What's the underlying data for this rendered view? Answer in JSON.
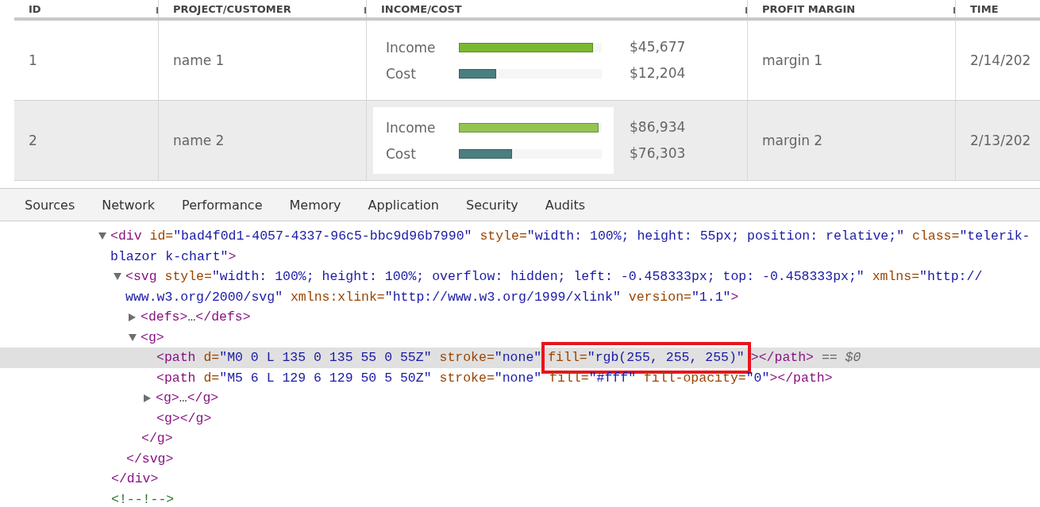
{
  "table": {
    "columns": [
      {
        "label": "ID"
      },
      {
        "label": "PROJECT/CUSTOMER"
      },
      {
        "label": "INCOME/COST"
      },
      {
        "label": "PROFIT MARGIN"
      },
      {
        "label": "TIME"
      }
    ],
    "rows": [
      {
        "id": "1",
        "name": "name 1",
        "hovered": false,
        "chart_white": false,
        "bars": [
          {
            "label": "Income",
            "level": 0.94,
            "color": "#7cb82f",
            "value": "$45,677"
          },
          {
            "label": "Cost",
            "level": 0.26,
            "color": "#4a7f80",
            "value": "$12,204"
          }
        ],
        "margin": "margin 1",
        "time": "2/14/202"
      },
      {
        "id": "2",
        "name": "name 2",
        "hovered": true,
        "chart_white": true,
        "bars": [
          {
            "label": "Income",
            "level": 0.98,
            "color": "#94c452",
            "value": "$86,934"
          },
          {
            "label": "Cost",
            "level": 0.37,
            "color": "#4a7f80",
            "value": "$76,303"
          }
        ],
        "margin": "margin 2",
        "time": "2/13/202"
      }
    ]
  },
  "devtools": {
    "tabs": [
      {
        "label": "Sources",
        "selected": false
      },
      {
        "label": "Network",
        "selected": false
      },
      {
        "label": "Performance",
        "selected": false
      },
      {
        "label": "Memory",
        "selected": false
      },
      {
        "label": "Application",
        "selected": false
      },
      {
        "label": "Security",
        "selected": false
      },
      {
        "label": "Audits",
        "selected": false
      }
    ],
    "tree": [
      {
        "expanded": true,
        "selected": false,
        "tokens": [
          {
            "kind": "tag",
            "text": "<div"
          },
          {
            "kind": "attr",
            "text": " id="
          },
          {
            "kind": "value",
            "text": "\"bad4f0d1-4057-4337-96c5-bbc9d96b7990\""
          },
          {
            "kind": "attr",
            "text": " style="
          },
          {
            "kind": "value",
            "text": "\"width: 100%; height: 55px; position: relative;\""
          },
          {
            "kind": "attr",
            "text": " class="
          },
          {
            "kind": "value",
            "text": "\"telerik-blazor k-chart\""
          },
          {
            "kind": "tag",
            "text": ">"
          }
        ],
        "children": [
          {
            "expanded": true,
            "selected": false,
            "tokens": [
              {
                "kind": "tag",
                "text": "<svg"
              },
              {
                "kind": "attr",
                "text": " style="
              },
              {
                "kind": "value",
                "text": "\"width: 100%; height: 100%; overflow: hidden; left: -0.458333px; top: -0.458333px;\""
              },
              {
                "kind": "attr",
                "text": " xmlns="
              },
              {
                "kind": "value",
                "text": "\"http:// www.w3.org/2000/svg\""
              },
              {
                "kind": "attr",
                "text": " xmlns:xlink="
              },
              {
                "kind": "value",
                "text": "\"http://www.w3.org/1999/xlink\""
              },
              {
                "kind": "attr",
                "text": " version="
              },
              {
                "kind": "value",
                "text": "\"1.1\""
              },
              {
                "kind": "tag",
                "text": ">"
              }
            ],
            "children": [
              {
                "expanded": false,
                "selected": false,
                "tokens": [
                  {
                    "kind": "tag",
                    "text": "<defs>"
                  },
                  {
                    "kind": "plain",
                    "text": "…"
                  },
                  {
                    "kind": "tag",
                    "text": "</defs>"
                  }
                ]
              },
              {
                "expanded": true,
                "selected": false,
                "tokens": [
                  {
                    "kind": "tag",
                    "text": "<g>"
                  }
                ],
                "children": [
                  {
                    "selected": true,
                    "tokens": [
                      {
                        "kind": "tag",
                        "text": "<path"
                      },
                      {
                        "kind": "attr",
                        "text": " d="
                      },
                      {
                        "kind": "value",
                        "text": "\"M0 0 L 135 0 135 55 0 55Z\""
                      },
                      {
                        "kind": "attr",
                        "text": " stroke="
                      },
                      {
                        "kind": "value",
                        "text": "\"none\""
                      },
                      {
                        "kind": "attr",
                        "text": " fill=",
                        "boxed": true
                      },
                      {
                        "kind": "value",
                        "text": "\"rgb(255, 255, 255)\"",
                        "boxed": true
                      },
                      {
                        "kind": "tag",
                        "text": "></path>"
                      },
                      {
                        "kind": "ref",
                        "text": " == $0"
                      }
                    ]
                  },
                  {
                    "selected": false,
                    "tokens": [
                      {
                        "kind": "tag",
                        "text": "<path"
                      },
                      {
                        "kind": "attr",
                        "text": " d="
                      },
                      {
                        "kind": "value",
                        "text": "\"M5 6 L 129 6 129 50 5 50Z\""
                      },
                      {
                        "kind": "attr",
                        "text": " stroke="
                      },
                      {
                        "kind": "value",
                        "text": "\"none\""
                      },
                      {
                        "kind": "attr",
                        "text": " fill="
                      },
                      {
                        "kind": "value",
                        "text": "\"#fff\""
                      },
                      {
                        "kind": "attr",
                        "text": " fill-opacity="
                      },
                      {
                        "kind": "value",
                        "text": "\"0\""
                      },
                      {
                        "kind": "tag",
                        "text": "></path>"
                      }
                    ]
                  },
                  {
                    "expanded": false,
                    "selected": false,
                    "tokens": [
                      {
                        "kind": "tag",
                        "text": "<g>"
                      },
                      {
                        "kind": "plain",
                        "text": "…"
                      },
                      {
                        "kind": "tag",
                        "text": "</g>"
                      }
                    ]
                  },
                  {
                    "selected": false,
                    "tokens": [
                      {
                        "kind": "tag",
                        "text": "<g></g>"
                      }
                    ]
                  }
                ],
                "close": "</g>"
              }
            ],
            "close": "</svg>"
          }
        ],
        "close": "</div>"
      },
      {
        "selected": false,
        "tokens": [
          {
            "kind": "comment",
            "text": "<!--!-->"
          }
        ]
      }
    ]
  }
}
